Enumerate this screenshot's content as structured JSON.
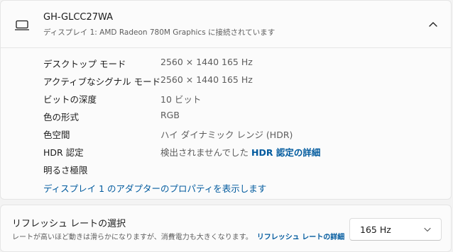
{
  "display": {
    "name": "GH-GLCC27WA",
    "subtitle": "ディスプレイ 1: AMD Radeon 780M Graphics に接続されています",
    "monitor_icon": "monitor-icon",
    "collapse_icon": "chevron-up-icon"
  },
  "info": [
    {
      "label": "デスクトップ モード",
      "value": "2560 × 1440 165 Hz"
    },
    {
      "label": "アクティブなシグナル モード",
      "value": "2560 × 1440 165 Hz"
    },
    {
      "label": "ビットの深度",
      "value": "10 ビット"
    },
    {
      "label": "色の形式",
      "value": "RGB"
    },
    {
      "label": "色空間",
      "value": "ハイ ダイナミック レンジ (HDR)"
    },
    {
      "label": "HDR 認定",
      "value": "検出されませんでした",
      "link": "HDR 認定の詳細"
    },
    {
      "label": "明るさ極限",
      "value": ""
    }
  ],
  "adapter_link": "ディスプレイ 1 のアダプターのプロパティを表示します",
  "refresh": {
    "title": "リフレッシュ レートの選択",
    "description": "レートが高いほど動きは滑らかになりますが、消費電力も大きくなります。",
    "link": "リフレッシュ レートの詳細",
    "selected": "165 Hz",
    "dropdown_icon": "chevron-down-icon"
  }
}
